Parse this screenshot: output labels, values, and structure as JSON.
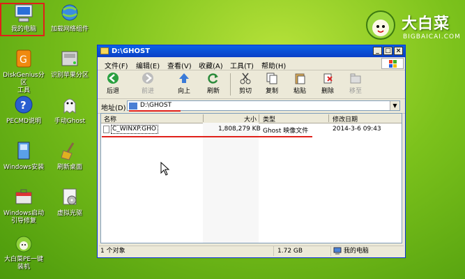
{
  "desktop": {
    "icons": [
      {
        "label": "我的电脑"
      },
      {
        "label": "加载网络组件"
      },
      {
        "label": "DiskGenius分区\n工具"
      },
      {
        "label": "识别苹果分区"
      },
      {
        "label": "PECMD说明"
      },
      {
        "label": "手动Ghost"
      },
      {
        "label": "Windows安装"
      },
      {
        "label": "刷新桌面"
      },
      {
        "label": "Windows启动\n引导修复"
      },
      {
        "label": "虚拟光驱"
      },
      {
        "label": "大白菜PE一键\n装机"
      }
    ]
  },
  "logo": {
    "title": "大白菜",
    "subtitle": "BIGBAICAI.COM"
  },
  "window": {
    "title": "D:\\GHOST",
    "menu": [
      "文件(F)",
      "编辑(E)",
      "查看(V)",
      "收藏(A)",
      "工具(T)",
      "帮助(H)"
    ],
    "toolbar": [
      {
        "label": "后退",
        "icon": "back-arrow-icon"
      },
      {
        "label": "前进",
        "icon": "forward-arrow-icon"
      },
      {
        "label": "向上",
        "icon": "up-arrow-icon"
      },
      {
        "label": "刷新",
        "icon": "refresh-icon"
      },
      {
        "label": "剪切",
        "icon": "scissors-icon"
      },
      {
        "label": "复制",
        "icon": "copy-icon"
      },
      {
        "label": "粘贴",
        "icon": "paste-icon"
      },
      {
        "label": "删除",
        "icon": "delete-icon"
      },
      {
        "label": "移至",
        "icon": "move-icon"
      }
    ],
    "address_label": "地址(D)",
    "address_value": "D:\\GHOST",
    "columns": {
      "name": "名称",
      "size": "大小",
      "type": "类型",
      "modified": "修改日期"
    },
    "files": [
      {
        "name": "C_WINXP.GHO",
        "size": "1,808,279 KB",
        "type": "Ghost 映像文件",
        "modified": "2014-3-6 09:43"
      }
    ],
    "status": {
      "count": "1 个对象",
      "size": "1.72 GB",
      "location": "我的电脑"
    }
  },
  "colors": {
    "highlight": "#e0201a",
    "titlebar": "#0a50d8"
  }
}
